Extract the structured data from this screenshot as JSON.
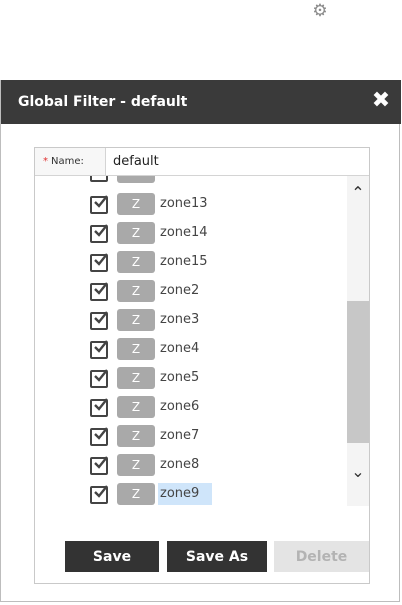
{
  "header": {
    "settings_icon": "gear-icon"
  },
  "dialog": {
    "title": "Global Filter - default",
    "close_icon": "close-icon",
    "name_label": "Name:",
    "required_mark": "*",
    "name_value": "default",
    "partial_item_name": "Z",
    "items": [
      {
        "badge": "Z",
        "name": "zone13",
        "checked": true,
        "selected": false
      },
      {
        "badge": "Z",
        "name": "zone14",
        "checked": true,
        "selected": false
      },
      {
        "badge": "Z",
        "name": "zone15",
        "checked": true,
        "selected": false
      },
      {
        "badge": "Z",
        "name": "zone2",
        "checked": true,
        "selected": false
      },
      {
        "badge": "Z",
        "name": "zone3",
        "checked": true,
        "selected": false
      },
      {
        "badge": "Z",
        "name": "zone4",
        "checked": true,
        "selected": false
      },
      {
        "badge": "Z",
        "name": "zone5",
        "checked": true,
        "selected": false
      },
      {
        "badge": "Z",
        "name": "zone6",
        "checked": true,
        "selected": false
      },
      {
        "badge": "Z",
        "name": "zone7",
        "checked": true,
        "selected": false
      },
      {
        "badge": "Z",
        "name": "zone8",
        "checked": true,
        "selected": false
      },
      {
        "badge": "Z",
        "name": "zone9",
        "checked": true,
        "selected": true
      }
    ],
    "buttons": {
      "save": "Save",
      "save_as": "Save As",
      "delete": "Delete"
    }
  },
  "colors": {
    "titlebar": "#3a3a3a",
    "badge": "#a9a9a9",
    "selection": "#cfe5fa",
    "required": "#e03030"
  }
}
